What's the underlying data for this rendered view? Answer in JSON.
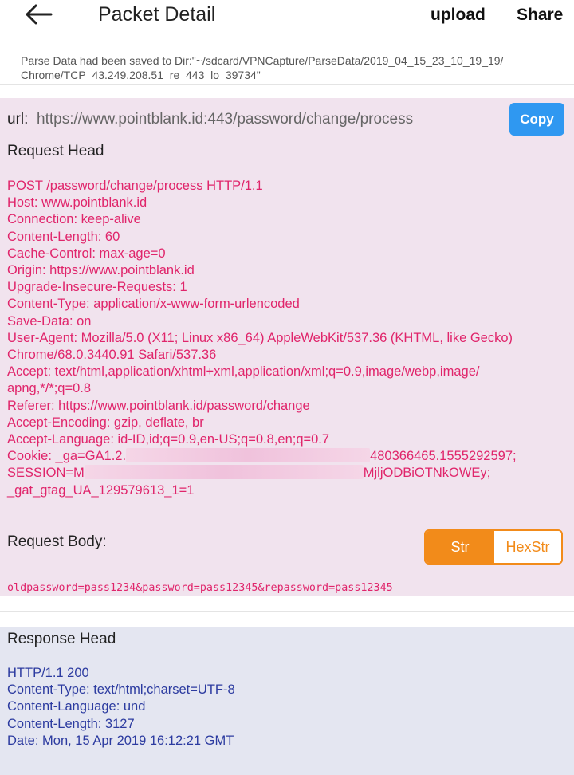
{
  "topbar": {
    "title": "Packet Detail",
    "upload_label": "upload",
    "share_label": "Share",
    "back_icon": "arrow-left-icon"
  },
  "save_path": {
    "line1": "Parse Data had been saved to Dir:\"~/sdcard/VPNCapture/ParseData/2019_04_15_23_10_19_19/",
    "line2": "Chrome/TCP_43.249.208.51_re_443_lo_39734\""
  },
  "request": {
    "url_label": "url:",
    "url_value": "https://www.pointblank.id:443/password/change/process",
    "copy_label": "Copy",
    "head_title": "Request Head",
    "head_lines": [
      "POST /password/change/process HTTP/1.1",
      "Host: www.pointblank.id",
      "Connection: keep-alive",
      "Content-Length: 60",
      "Cache-Control: max-age=0",
      "Origin: https://www.pointblank.id",
      "Upgrade-Insecure-Requests: 1",
      "Content-Type: application/x-www-form-urlencoded",
      "Save-Data: on",
      "User-Agent: Mozilla/5.0 (X11; Linux x86_64) AppleWebKit/537.36 (KHTML, like Gecko)",
      "Chrome/68.0.3440.91 Safari/537.36",
      "Accept: text/html,application/xhtml+xml,application/xml;q=0.9,image/webp,image/",
      "apng,*/*;q=0.8",
      "Referer: https://www.pointblank.id/password/change",
      "Accept-Encoding: gzip, deflate, br",
      "Accept-Language: id-ID,id;q=0.9,en-US;q=0.8,en;q=0.7"
    ],
    "cookie": {
      "line1_prefix": "Cookie: _ga=GA1.2.",
      "line1_suffix": "480366465.1555292597;",
      "line2_prefix": "SESSION=M",
      "line2_suffix": "MjljODBiOTNkOWEy;",
      "line3": "_gat_gtag_UA_129579613_1=1"
    },
    "body_title": "Request Body:",
    "body_toggle": {
      "str_label": "Str",
      "hexstr_label": "HexStr",
      "selected": "Str"
    },
    "body_value": "oldpassword=pass1234&password=pass12345&repassword=pass12345",
    "colors": {
      "text": "#e0256b",
      "background": "#f1e3ee",
      "toggle_accent": "#f28b1a",
      "copy_button": "#2f98f1"
    }
  },
  "response": {
    "head_title": "Response Head",
    "head_lines": [
      "HTTP/1.1 200",
      "Content-Type: text/html;charset=UTF-8",
      "Content-Language: und",
      "Content-Length: 3127",
      "Date: Mon, 15 Apr 2019 16:12:21 GMT"
    ],
    "colors": {
      "text": "#2c3ba0",
      "background": "#e4e6f1"
    }
  }
}
